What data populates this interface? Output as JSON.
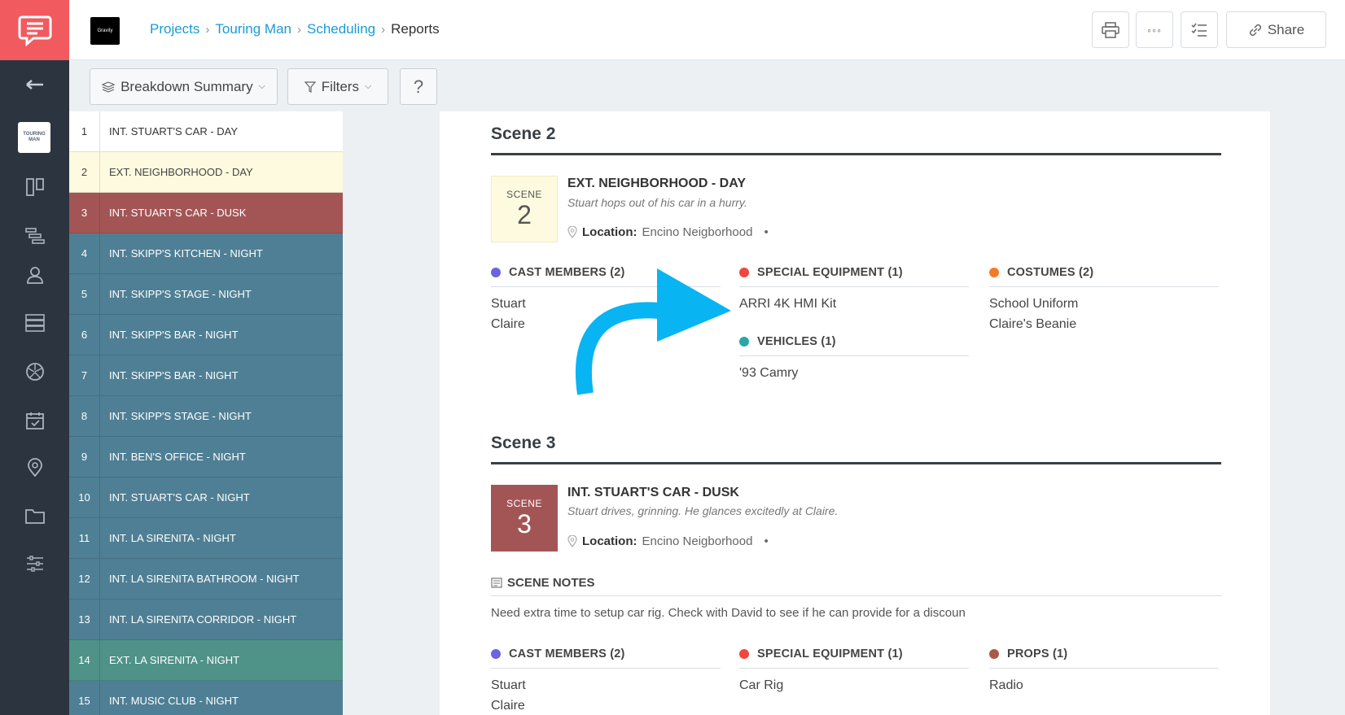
{
  "header": {
    "brand_text": "Gravity",
    "breadcrumbs": [
      "Projects",
      "Touring Man",
      "Scheduling"
    ],
    "current": "Reports",
    "share_label": "Share"
  },
  "toolbar": {
    "view_label": "Breakdown Summary",
    "filters_label": "Filters",
    "help_label": "?"
  },
  "rail": {
    "project_thumb_text": "TOURING MAN"
  },
  "scenes": [
    {
      "num": "1",
      "name": "INT. STUART'S CAR - DAY",
      "color": "white"
    },
    {
      "num": "2",
      "name": "EXT. NEIGHBORHOOD - DAY",
      "color": "yellow"
    },
    {
      "num": "3",
      "name": "INT. STUART'S CAR - DUSK",
      "color": "red"
    },
    {
      "num": "4",
      "name": "INT. SKIPP'S KITCHEN - NIGHT",
      "color": "blue"
    },
    {
      "num": "5",
      "name": "INT. SKIPP'S STAGE - NIGHT",
      "color": "blue"
    },
    {
      "num": "6",
      "name": "INT. SKIPP'S BAR - NIGHT",
      "color": "blue"
    },
    {
      "num": "7",
      "name": "INT. SKIPP'S BAR - NIGHT",
      "color": "blue"
    },
    {
      "num": "8",
      "name": "INT. SKIPP'S STAGE - NIGHT",
      "color": "blue"
    },
    {
      "num": "9",
      "name": "INT. BEN'S OFFICE - NIGHT",
      "color": "blue"
    },
    {
      "num": "10",
      "name": "INT. STUART'S CAR - NIGHT",
      "color": "blue"
    },
    {
      "num": "11",
      "name": "INT. LA SIRENITA - NIGHT",
      "color": "blue"
    },
    {
      "num": "12",
      "name": "INT. LA SIRENITA BATHROOM - NIGHT",
      "color": "blue"
    },
    {
      "num": "13",
      "name": "INT. LA SIRENITA CORRIDOR - NIGHT",
      "color": "blue"
    },
    {
      "num": "14",
      "name": "EXT. LA SIRENITA - NIGHT",
      "color": "teal"
    },
    {
      "num": "15",
      "name": "INT. MUSIC CLUB - NIGHT",
      "color": "blue"
    }
  ],
  "report": {
    "scene2": {
      "title": "Scene 2",
      "box_label": "SCENE",
      "box_num": "2",
      "slug": "EXT. NEIGHBORHOOD - DAY",
      "desc": "Stuart hops out of his car in a hurry.",
      "loc_label": "Location:",
      "loc_value": "Encino Neigborhood",
      "cast_head": "CAST MEMBERS (2)",
      "cast": [
        "Stuart",
        "Claire"
      ],
      "equip_head": "SPECIAL EQUIPMENT (1)",
      "equip": [
        "ARRI 4K HMI Kit"
      ],
      "vehicles_head": "VEHICLES (1)",
      "vehicles": [
        "'93 Camry"
      ],
      "costumes_head": "COSTUMES (2)",
      "costumes": [
        "School Uniform",
        "Claire's Beanie"
      ]
    },
    "scene3": {
      "title": "Scene 3",
      "box_label": "SCENE",
      "box_num": "3",
      "slug": "INT. STUART'S CAR - DUSK",
      "desc": "Stuart drives, grinning. He glances excitedly at Claire.",
      "loc_label": "Location:",
      "loc_value": "Encino Neigborhood",
      "notes_head": "SCENE NOTES",
      "notes": "Need extra time to setup car rig. Check with David to see if he can provide for a discoun",
      "cast_head": "CAST MEMBERS (2)",
      "cast": [
        "Stuart",
        "Claire"
      ],
      "equip_head": "SPECIAL EQUIPMENT (1)",
      "equip": [
        "Car Rig"
      ],
      "props_head": "PROPS (1)",
      "props": [
        "Radio"
      ]
    }
  },
  "colors": {
    "cast": "#6c63e0",
    "equipment": "#f0473e",
    "vehicles": "#2aa6a8",
    "costumes": "#f47a2a",
    "props": "#a85a48",
    "arrow": "#08b4f2"
  }
}
